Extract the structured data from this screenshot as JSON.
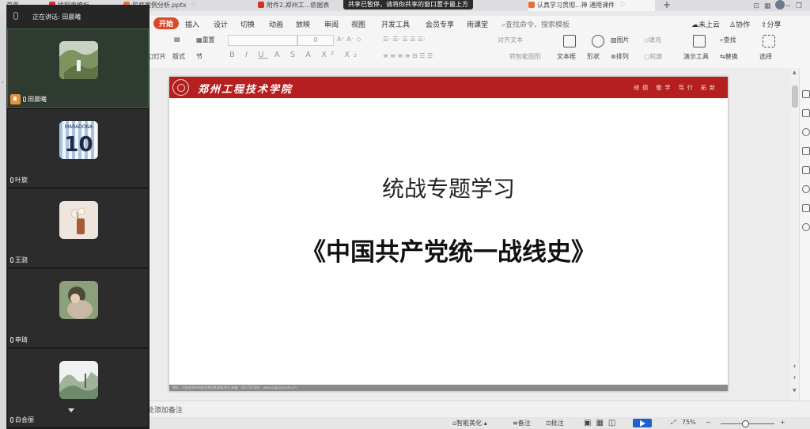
{
  "tabs": [
    {
      "label": "首页",
      "color": "#e05a2b"
    },
    {
      "label": "找稻壳模板",
      "color": "#d93025"
    },
    {
      "label": "民庭案例分析.pptx",
      "color": "#e8712b"
    },
    {
      "label": "附件2.郑州工...依据表",
      "color": "#d93025"
    },
    {
      "label": "认真学习贯彻...神 通用课件",
      "color": "#e8712b"
    }
  ],
  "toast": "共享已暂停，请将你共享的窗口置于最上方",
  "menu": {
    "items": [
      "开始",
      "插入",
      "设计",
      "切换",
      "动画",
      "放映",
      "审阅",
      "视图",
      "开发工具",
      "会员专享",
      "雨课堂"
    ],
    "search": "查找命令、搜索模板",
    "right": [
      "未上云",
      "协作",
      "分享"
    ]
  },
  "ribbon": {
    "left1": "重置",
    "left2": [
      "幻灯片",
      "版式",
      "节"
    ],
    "font_size": "0",
    "format_chars": [
      "B",
      "I",
      "U",
      "A",
      "S",
      "A",
      "X²",
      "X₂"
    ],
    "align_text": "对齐文本",
    "smartart": "转智能图形",
    "textbox": "文本框",
    "shape": "形状",
    "picture": "图片",
    "arrange": "排列",
    "fill": "填充",
    "outline": "轮廓",
    "present_tools": "演示工具",
    "find": "查找",
    "replace": "替换",
    "select": "选择"
  },
  "slide": {
    "school_name": "郑州工程技术学院",
    "motto": "修德 敬学 笃行 拓新",
    "subtitle": "统战专题学习",
    "main_title": "《中国共产党统一战线史》",
    "footer_text": "地址：河南省郑州市航空港区象湖路18号  邮编：451150  网址：www.zzgcjsxy.edu.cn"
  },
  "notes_placeholder": "处添加备注",
  "status": {
    "beautify": "智能美化",
    "notes": "备注",
    "comment": "批注",
    "zoom": "75%",
    "zoom_level": 0.45
  },
  "meeting": {
    "speaking": "正在讲话: 田晨曦",
    "participants": [
      {
        "name": "田晨曦",
        "thumb_colors": [
          "#9fb07a",
          "#6d7f4e",
          "#d8dbd2"
        ],
        "selected": true
      },
      {
        "name": "叶旋",
        "thumb_text": "MARADONA 10",
        "thumb_colors": [
          "#d7e3ef",
          "#1f2a4a",
          "#f7f7f7"
        ]
      },
      {
        "name": "王骁",
        "thumb_colors": [
          "#e9e1d9",
          "#a65a3a",
          "#f2ede6"
        ]
      },
      {
        "name": "申琦",
        "thumb_colors": [
          "#c9b8a8",
          "#4e4a3a",
          "#8da07c"
        ]
      },
      {
        "name": "白会丽",
        "thumb_colors": [
          "#dfe6e6",
          "#6f8a6a",
          "#eef2f2"
        ]
      }
    ]
  }
}
